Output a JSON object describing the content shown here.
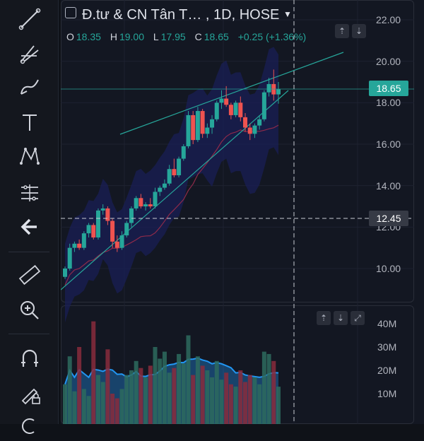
{
  "symbol": {
    "title": "Đ.tư & CN Tân T… , 1D, HOSE",
    "dropdown_icon": "caret-down-icon"
  },
  "ohlc": {
    "o_label": "O",
    "o_value": "18.35",
    "h_label": "H",
    "h_value": "19.00",
    "l_label": "L",
    "l_value": "17.95",
    "c_label": "C",
    "c_value": "18.65",
    "change": "+0.25 (+1.36%)"
  },
  "price_axis": {
    "labels": [
      "22.00",
      "20.00",
      "18.00",
      "16.00",
      "14.00",
      "12.00",
      "10.00"
    ],
    "last_price": "18.65",
    "crosshair_price": "12.45"
  },
  "volume_axis": {
    "labels": [
      "40M",
      "30M",
      "20M",
      "10M"
    ]
  },
  "colors": {
    "up": "#26a69a",
    "down": "#ef5350",
    "background": "#131722",
    "band": "#1a1f55",
    "volume_ma": "#2196f3"
  },
  "toolbar": {
    "icons": [
      "trend-line-icon",
      "pitchfork-icon",
      "brush-icon",
      "text-icon",
      "pattern-icon",
      "measure-icon",
      "back-arrow-icon",
      "ruler-icon",
      "zoom-in-icon",
      "magnet-icon",
      "lock-drawing-icon"
    ]
  },
  "chart_data": {
    "type": "candlestick",
    "ohlc_series": [
      [
        9.6,
        10.1,
        9.5,
        10.0
      ],
      [
        10.0,
        11.2,
        9.9,
        11.0
      ],
      [
        11.0,
        11.3,
        10.8,
        11.2
      ],
      [
        11.2,
        11.4,
        10.9,
        11.0
      ],
      [
        11.0,
        11.8,
        10.9,
        11.7
      ],
      [
        11.7,
        12.2,
        11.5,
        12.1
      ],
      [
        12.1,
        12.2,
        11.4,
        11.5
      ],
      [
        11.5,
        12.9,
        11.4,
        12.8
      ],
      [
        12.8,
        13.1,
        12.6,
        12.9
      ],
      [
        12.9,
        13.0,
        12.1,
        12.3
      ],
      [
        12.3,
        12.4,
        11.0,
        11.3
      ],
      [
        11.3,
        11.6,
        10.8,
        11.0
      ],
      [
        11.0,
        11.8,
        10.9,
        11.6
      ],
      [
        11.6,
        12.3,
        11.5,
        12.2
      ],
      [
        12.2,
        13.0,
        12.0,
        12.9
      ],
      [
        12.9,
        13.5,
        12.8,
        13.4
      ],
      [
        13.4,
        13.6,
        12.9,
        13.0
      ],
      [
        13.0,
        13.2,
        12.8,
        13.1
      ],
      [
        13.1,
        13.4,
        12.9,
        13.0
      ],
      [
        13.0,
        13.9,
        12.9,
        13.7
      ],
      [
        13.7,
        14.0,
        13.5,
        13.9
      ],
      [
        13.9,
        14.3,
        13.8,
        14.1
      ],
      [
        14.1,
        15.0,
        14.0,
        14.8
      ],
      [
        14.8,
        15.3,
        14.4,
        14.5
      ],
      [
        14.5,
        15.4,
        14.4,
        15.3
      ],
      [
        15.3,
        16.0,
        15.2,
        15.9
      ],
      [
        15.9,
        17.6,
        15.8,
        17.4
      ],
      [
        17.4,
        17.6,
        16.0,
        16.2
      ],
      [
        16.2,
        17.8,
        16.1,
        17.6
      ],
      [
        17.6,
        17.7,
        16.3,
        16.5
      ],
      [
        16.5,
        17.0,
        16.3,
        16.8
      ],
      [
        16.8,
        17.4,
        16.5,
        17.2
      ],
      [
        17.2,
        18.1,
        17.1,
        18.0
      ],
      [
        18.0,
        18.6,
        17.7,
        18.2
      ],
      [
        18.2,
        18.8,
        17.8,
        17.9
      ],
      [
        17.9,
        18.0,
        17.2,
        17.4
      ],
      [
        17.4,
        18.1,
        17.3,
        18.0
      ],
      [
        18.0,
        18.3,
        17.1,
        17.3
      ],
      [
        17.3,
        17.5,
        16.6,
        16.8
      ],
      [
        16.8,
        17.0,
        16.2,
        16.5
      ],
      [
        16.5,
        17.0,
        16.3,
        16.9
      ],
      [
        16.9,
        17.4,
        16.7,
        17.2
      ],
      [
        17.2,
        18.6,
        17.1,
        18.5
      ],
      [
        18.5,
        19.2,
        18.3,
        18.9
      ],
      [
        18.9,
        19.6,
        18.1,
        18.4
      ],
      [
        18.4,
        19.0,
        17.95,
        18.65
      ]
    ],
    "volume": [
      14,
      26,
      11,
      30,
      12,
      9,
      41,
      18,
      15,
      29,
      10,
      8,
      12,
      18,
      20,
      24,
      21,
      17,
      22,
      30,
      25,
      28,
      19,
      21,
      27,
      23,
      35,
      18,
      26,
      22,
      20,
      17,
      24,
      16,
      19,
      14,
      13,
      20,
      15,
      18,
      17,
      14,
      28,
      27,
      24,
      13
    ],
    "ylim": [
      8.5,
      22.5
    ],
    "vol_ylim": [
      0,
      45
    ]
  }
}
